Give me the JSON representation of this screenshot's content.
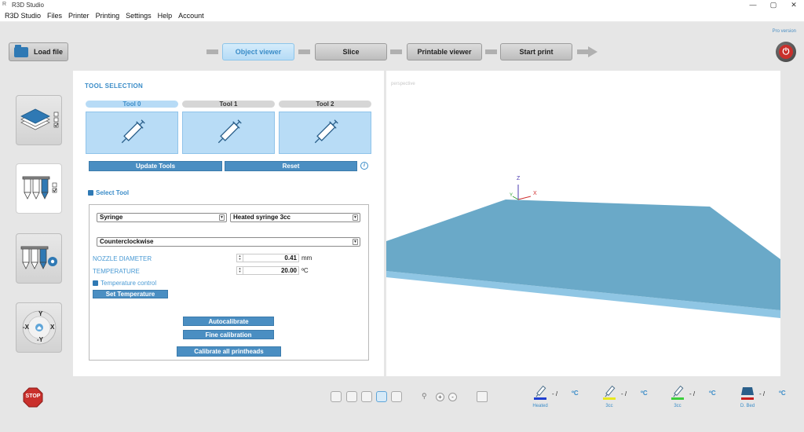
{
  "window": {
    "title": "R3D Studio",
    "icon_glyph": "R"
  },
  "window_controls": {
    "minimize": "—",
    "maximize": "▢",
    "close": "✕"
  },
  "menu": [
    "R3D Studio",
    "Files",
    "Printer",
    "Printing",
    "Settings",
    "Help",
    "Account"
  ],
  "pro_label": "Pro version",
  "toolbar": {
    "load_label": "Load file",
    "steps": [
      {
        "label": "Object viewer",
        "active": true
      },
      {
        "label": "Slice",
        "active": false
      },
      {
        "label": "Printable viewer",
        "active": false
      },
      {
        "label": "Start print",
        "active": false
      }
    ]
  },
  "side_buttons": [
    {
      "name": "layers",
      "active": false
    },
    {
      "name": "tool-selection",
      "active": true
    },
    {
      "name": "tool-settings",
      "active": false
    },
    {
      "name": "axis-control",
      "active": false
    }
  ],
  "axis_labels": {
    "y_pos": "Y",
    "y_neg": "-Y",
    "x_pos": "X",
    "x_neg": "-X"
  },
  "tool_selection": {
    "title": "TOOL SELECTION",
    "tools": [
      {
        "label": "Tool 0",
        "active": true
      },
      {
        "label": "Tool 1",
        "active": false
      },
      {
        "label": "Tool 2",
        "active": false
      }
    ],
    "update_label": "Update Tools",
    "reset_label": "Reset",
    "info_glyph": "i",
    "select_tool_label": "Select Tool",
    "tool_type": "Syringe",
    "syringe_model": "Heated syringe 3cc",
    "rotation": "Counterclockwise",
    "nozzle_label": "NOZZLE DIAMETER",
    "nozzle_value": "0.41",
    "nozzle_unit": "mm",
    "temp_label": "TEMPERATURE",
    "temp_value": "20.00",
    "temp_unit": "ºC",
    "temp_control_label": "Temperature control",
    "set_temp_label": "Set Temperature",
    "autocalibrate_label": "Autocalibrate",
    "fine_calibration_label": "Fine calibration",
    "calibrate_all_label": "Calibrate all printheads"
  },
  "viewport": {
    "label": "perspective",
    "axis_z": "Z",
    "axis_y": "Y",
    "axis_x": "X",
    "bed_color": "#6aa9c8"
  },
  "bottom": {
    "stop_label": "STOP",
    "zoom_minus": "-",
    "zoom_plus": "+",
    "printheads": [
      {
        "label": "Heated",
        "value": "- /",
        "unit": "ºC",
        "color": "#1f3fd1"
      },
      {
        "label": "3cc",
        "value": "- /",
        "unit": "ºC",
        "color": "#e8e820"
      },
      {
        "label": "3cc",
        "value": "- /",
        "unit": "ºC",
        "color": "#3ccf3c"
      },
      {
        "label": "D. Bed",
        "value": "- /",
        "unit": "ºC",
        "color": "#c82020"
      }
    ]
  }
}
